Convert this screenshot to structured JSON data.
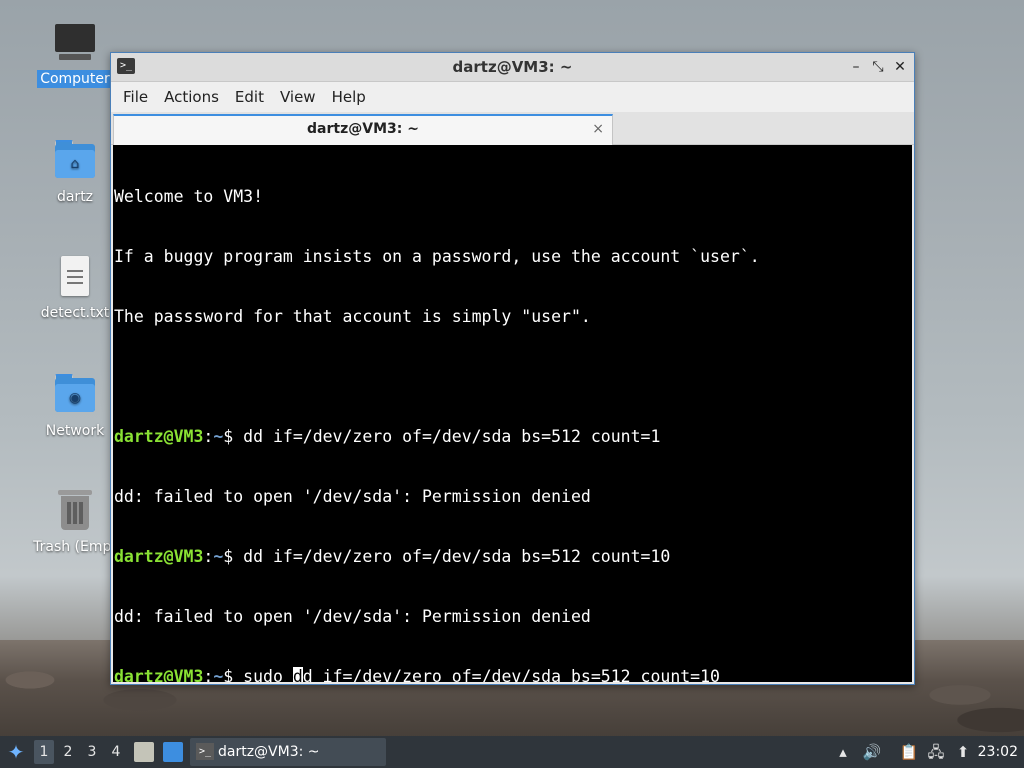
{
  "desktop": {
    "icons": [
      {
        "label": "Computer",
        "icon": "computer-icon"
      },
      {
        "label": "dartz",
        "icon": "home-folder-icon"
      },
      {
        "label": "detect.txt",
        "icon": "text-file-icon"
      },
      {
        "label": "Network",
        "icon": "network-folder-icon"
      },
      {
        "label": "Trash (Empt",
        "icon": "trash-icon"
      }
    ]
  },
  "window": {
    "title": "dartz@VM3: ~",
    "menu": [
      "File",
      "Actions",
      "Edit",
      "View",
      "Help"
    ],
    "tab_label": "dartz@VM3: ~",
    "tab_close": "×"
  },
  "terminal": {
    "motd": [
      "Welcome to VM3!",
      "If a buggy program insists on a password, use the account `user`.",
      "The passsword for that account is simply \"user\"."
    ],
    "prompt_user": "dartz@VM3",
    "prompt_sep": ":",
    "prompt_path": "~",
    "prompt_dollar": "$ ",
    "cmd1": "dd if=/dev/zero of=/dev/sda bs=512 count=1",
    "err1": "dd: failed to open '/dev/sda': Permission denied",
    "cmd2": "dd if=/dev/zero of=/dev/sda bs=512 count=10",
    "err2": "dd: failed to open '/dev/sda': Permission denied",
    "cmd3_before": "sudo ",
    "cmd3_cursor": "d",
    "cmd3_after": "d if=/dev/zero of=/dev/sda bs=512 count=10"
  },
  "taskbar": {
    "workspaces": [
      "1",
      "2",
      "3",
      "4"
    ],
    "active_workspace": "1",
    "task_label": "dartz@VM3: ~",
    "clock": "23:02"
  },
  "colors": {
    "prompt_user": "#8ae234",
    "prompt_path": "#729fcf",
    "accent": "#3d8ee0"
  }
}
